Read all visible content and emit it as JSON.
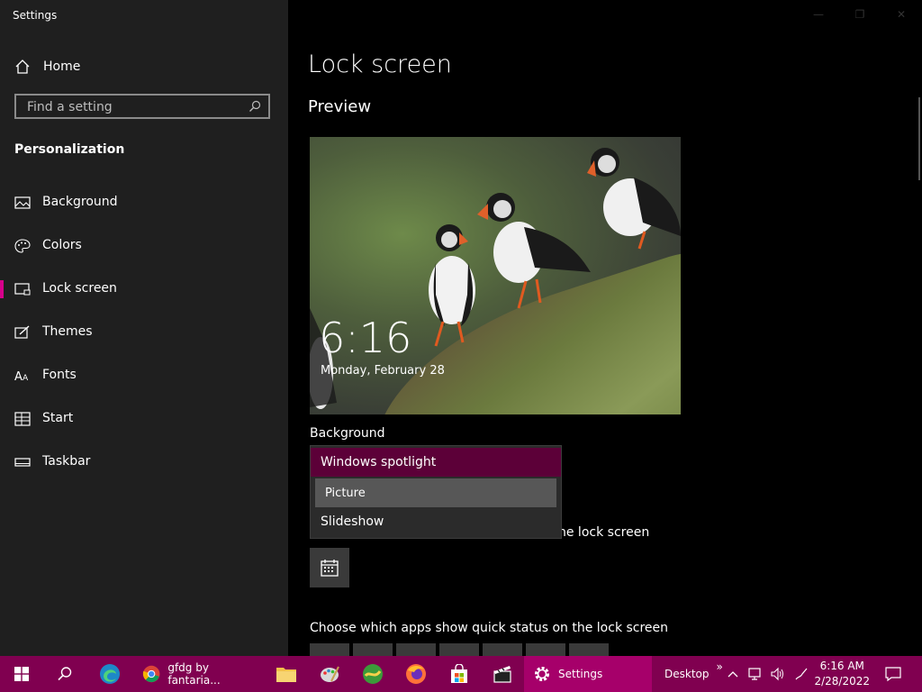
{
  "window": {
    "title": "Settings"
  },
  "sidebar": {
    "home_label": "Home",
    "search_placeholder": "Find a setting",
    "section_title": "Personalization",
    "items": [
      {
        "label": "Background",
        "icon": "picture-icon"
      },
      {
        "label": "Colors",
        "icon": "palette-icon"
      },
      {
        "label": "Lock screen",
        "icon": "lock-screen-icon",
        "active": true
      },
      {
        "label": "Themes",
        "icon": "brush-icon"
      },
      {
        "label": "Fonts",
        "icon": "font-icon"
      },
      {
        "label": "Start",
        "icon": "start-icon"
      },
      {
        "label": "Taskbar",
        "icon": "taskbar-icon"
      }
    ]
  },
  "main": {
    "title": "Lock screen",
    "preview_title": "Preview",
    "preview_time": "6:16",
    "preview_date": "Monday, February 28",
    "background_label": "Background",
    "background_options": [
      "Windows spotlight",
      "Picture",
      "Slideshow"
    ],
    "selected_option": "Windows spotlight",
    "partial_text": "he lock screen",
    "quick_status_title": "Choose which apps show quick status on the lock screen"
  },
  "taskbar": {
    "chrome_label": "gfdg by fantaria...",
    "settings_label": "Settings",
    "desktop_label": "Desktop",
    "chevron": "»",
    "time": "6:16 AM",
    "date": "2/28/2022"
  },
  "colors": {
    "accent": "#d6008a",
    "taskbar": "#800050",
    "selected": "#5c0038"
  }
}
